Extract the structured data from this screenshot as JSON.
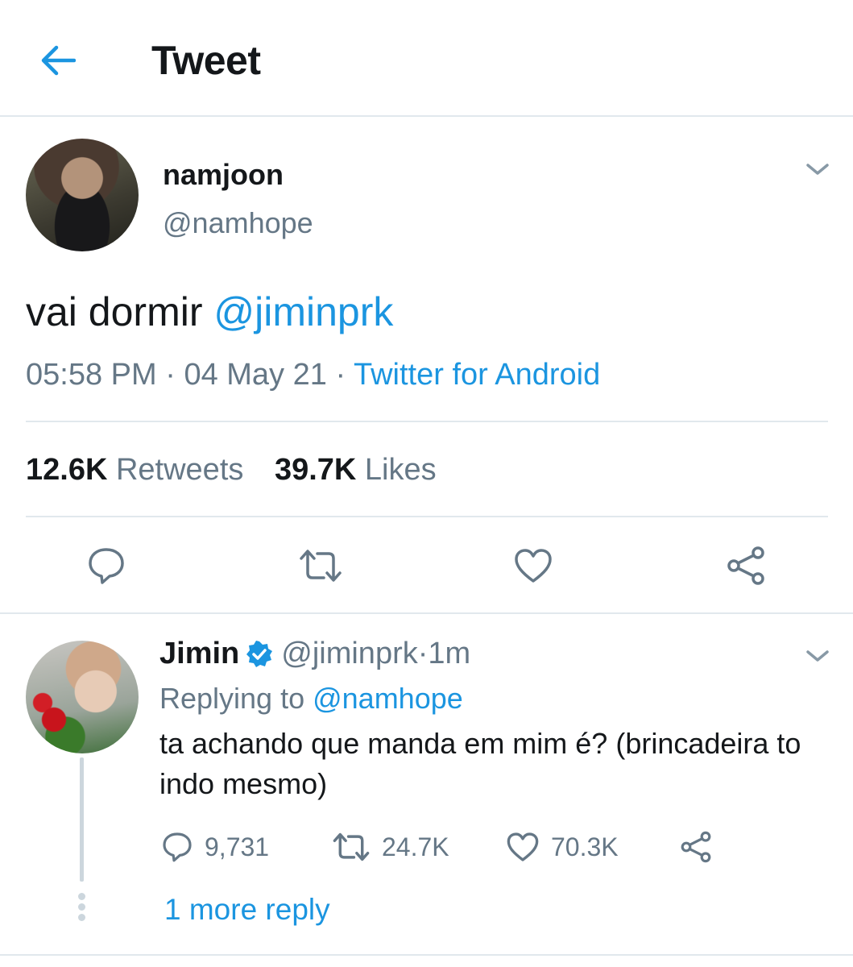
{
  "header": {
    "title": "Tweet",
    "back_icon": "arrow-left-icon",
    "accent_color": "#1b95e0"
  },
  "tweet": {
    "author_name": "namjoon",
    "author_handle": "@namhope",
    "text_prefix": "vai dormir ",
    "mention": "@jiminprk",
    "time": "05:58 PM",
    "date_sep": " · ",
    "date": "04 May 21",
    "source_sep": " · ",
    "source": "Twitter for Android",
    "retweets_count": "12.6K",
    "retweets_label": "Retweets",
    "likes_count": "39.7K",
    "likes_label": "Likes",
    "actions": [
      "reply-icon",
      "retweet-icon",
      "like-icon",
      "share-icon"
    ]
  },
  "reply": {
    "author_name": "Jimin",
    "verified_icon": "verified-badge-icon",
    "author_handle": "@jiminprk",
    "time_sep": " · ",
    "time": "1m",
    "replying_prefix": "Replying to ",
    "replying_to": "@namhope",
    "text": "ta achando que manda em mim é? (brincadeira to indo mesmo)",
    "reply_count": "9,731",
    "retweet_count": "24.7K",
    "like_count": "70.3K"
  },
  "thread": {
    "more_replies": "1 more reply"
  }
}
